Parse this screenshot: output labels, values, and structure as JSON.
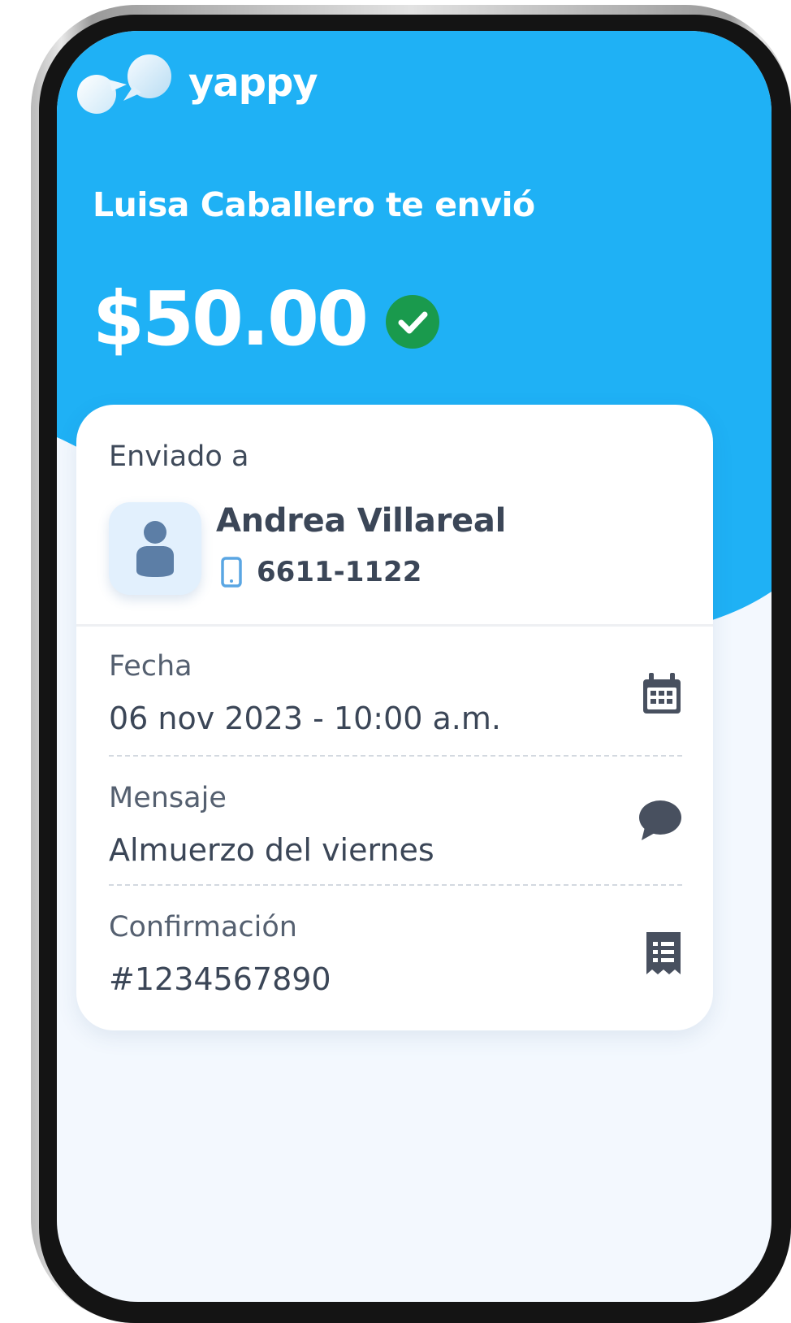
{
  "colors": {
    "hero_blue": "#1fb1f5",
    "screen_background": "#f3f8fe",
    "success_green": "#1a9a4d",
    "text_dark": "#3b4657",
    "text_muted": "#556070",
    "icon_dark": "#48505f",
    "avatar_blue": "#5c7ea6"
  },
  "brand": {
    "name": "yappy",
    "logo_icon": "speech-bubbles-icon"
  },
  "header": {
    "sender_line": "Luisa Caballero te envió",
    "amount": "$50.00",
    "status_icon": "check-circle-icon"
  },
  "card": {
    "sent_to_label": "Enviado a",
    "recipient": {
      "name": "Andrea Villareal",
      "phone": "6611-1122",
      "avatar_icon": "person-icon",
      "phone_icon": "mobile-phone-icon"
    },
    "details": [
      {
        "label": "Fecha",
        "value": "06 nov 2023  - 10:00 a.m.",
        "icon": "calendar-icon"
      },
      {
        "label": "Mensaje",
        "value": "Almuerzo del viernes",
        "icon": "chat-bubble-icon"
      },
      {
        "label": "Confirmación",
        "value": "#1234567890",
        "icon": "receipt-icon"
      }
    ]
  }
}
